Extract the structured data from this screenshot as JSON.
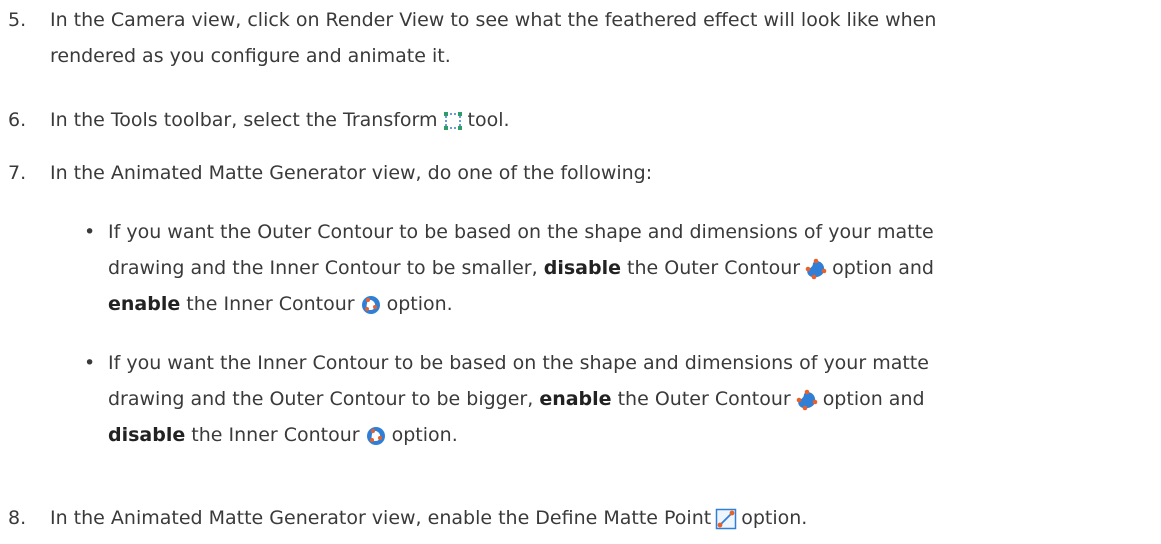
{
  "steps": [
    {
      "num": "5.",
      "line1": "In the Camera view, click on Render View to see what the feathered effect will look like when",
      "line2": "rendered as you configure and animate it."
    },
    {
      "num": "6.",
      "before": "In the Tools toolbar, select the Transform",
      "after": "tool.",
      "icon": "transform-tool-icon"
    },
    {
      "num": "7.",
      "text": "In the Animated Matte Generator view, do one of the following:"
    },
    {
      "num": "8.",
      "before": "In the Animated Matte Generator view, enable the Define Matte Point",
      "after": "option.",
      "icon": "define-matte-point-icon"
    }
  ],
  "bullets": [
    {
      "line1": "If you want the Outer Contour to be based on the shape and dimensions of your matte",
      "line2_pre": "drawing and the Inner Contour to be smaller,",
      "kw1": "disable",
      "line2_mid": "the Outer Contour",
      "line2_post": "option and",
      "kw2": "enable",
      "line3_mid": "the Inner Contour",
      "line3_post": "option."
    },
    {
      "line1": "If you want the Inner Contour to be based on the shape and dimensions of your matte",
      "line2_pre": "drawing and the Outer Contour to be bigger,",
      "kw1": "enable",
      "line2_mid": "the Outer Contour",
      "line2_post": "option and",
      "kw2": "disable",
      "line3_mid": "the Inner Contour",
      "line3_post": "option."
    }
  ],
  "bullet_char": "•",
  "icons": {
    "outer": "outer-contour-icon",
    "inner": "inner-contour-icon"
  },
  "colors": {
    "text": "#3a3a3a",
    "icon_blue": "#2f7fd6",
    "icon_orange": "#e8602a"
  }
}
